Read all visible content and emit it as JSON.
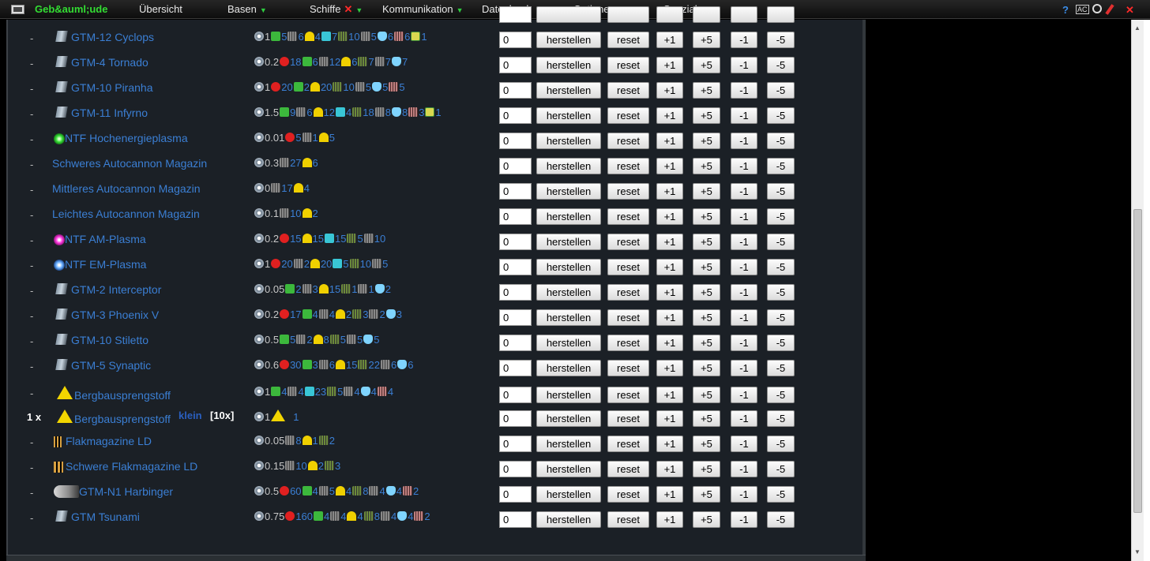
{
  "menu": {
    "items": [
      {
        "label": "Geb&auml;ude",
        "active": true,
        "arrow": false,
        "x": false
      },
      {
        "label": "Übersicht",
        "active": false,
        "arrow": false,
        "x": false
      },
      {
        "label": "Basen",
        "active": false,
        "arrow": true,
        "x": false
      },
      {
        "label": "Schiffe",
        "active": false,
        "arrow": true,
        "x": true
      },
      {
        "label": "Kommunikation",
        "active": false,
        "arrow": true,
        "x": false
      },
      {
        "label": "Datenbank",
        "active": false,
        "arrow": true,
        "x": false
      },
      {
        "label": "Optionen",
        "active": false,
        "arrow": true,
        "x": false
      },
      {
        "label": "Spezial",
        "active": false,
        "arrow": true,
        "x": false
      }
    ],
    "tools": [
      "help-icon",
      "ac-icon",
      "magnifier-icon",
      "pencil-icon",
      "close-icon"
    ],
    "help_glyph": "?",
    "ac_glyph": "AC",
    "close_glyph": "✕",
    "arrow_glyph": "▼",
    "x_glyph": "✕"
  },
  "colors": {
    "link": "#3b7fd4",
    "menu_active": "#33dd33",
    "arrow": "#2ecc40",
    "panel_bg": "#1b2026"
  },
  "buttons": {
    "herstellen": "herstellen",
    "reset": "reset",
    "plus1": "+1",
    "plus5": "+5",
    "minus1": "-1",
    "minus5": "-5"
  },
  "rows": [
    {
      "qty": "-",
      "name": "GTM-12 Cyclops",
      "icon": "ship-icon",
      "value": "0",
      "costs": [
        [
          "time",
          "1"
        ],
        [
          "green",
          "5"
        ],
        [
          "grey",
          "6"
        ],
        [
          "yellow",
          "4"
        ],
        [
          "cyan",
          "7"
        ],
        [
          "olive",
          "10"
        ],
        [
          "grey",
          "5"
        ],
        [
          "crystal",
          "6"
        ],
        [
          "pink",
          "6"
        ],
        [
          "chip",
          "1"
        ]
      ]
    },
    {
      "qty": "-",
      "name": "GTM-4 Tornado",
      "icon": "ship-icon",
      "value": "0",
      "costs": [
        [
          "time",
          "0.2"
        ],
        [
          "red",
          "18"
        ],
        [
          "green",
          "6"
        ],
        [
          "grey",
          "12"
        ],
        [
          "yellow",
          "6"
        ],
        [
          "olive",
          "7"
        ],
        [
          "grey",
          "7"
        ],
        [
          "crystal",
          "7"
        ]
      ]
    },
    {
      "qty": "-",
      "name": "GTM-10 Piranha",
      "icon": "ship-icon",
      "value": "0",
      "costs": [
        [
          "time",
          "1"
        ],
        [
          "red",
          "20"
        ],
        [
          "green",
          "2"
        ],
        [
          "yellow",
          "20"
        ],
        [
          "olive",
          "10"
        ],
        [
          "grey",
          "5"
        ],
        [
          "crystal",
          "5"
        ],
        [
          "pink",
          "5"
        ]
      ]
    },
    {
      "qty": "-",
      "name": "GTM-11 Infyrno",
      "icon": "ship-icon",
      "value": "0",
      "costs": [
        [
          "time",
          "1.5"
        ],
        [
          "green",
          "9"
        ],
        [
          "grey",
          "6"
        ],
        [
          "yellow",
          "12"
        ],
        [
          "cyan",
          "4"
        ],
        [
          "olive",
          "18"
        ],
        [
          "grey",
          "8"
        ],
        [
          "crystal",
          "8"
        ],
        [
          "pink",
          "3"
        ],
        [
          "chip",
          "1"
        ]
      ]
    },
    {
      "qty": "-",
      "name": "NTF Hochenergieplasma",
      "icon": "green-orb-icon",
      "value": "0",
      "costs": [
        [
          "time",
          "0.01"
        ],
        [
          "red",
          "5"
        ],
        [
          "grey",
          "1"
        ],
        [
          "yellow",
          "5"
        ]
      ]
    },
    {
      "qty": "-",
      "name": "Schweres Autocannon Magazin",
      "icon": "",
      "value": "0",
      "costs": [
        [
          "time",
          "0.3"
        ],
        [
          "grey",
          "27"
        ],
        [
          "yellow",
          "6"
        ]
      ]
    },
    {
      "qty": "-",
      "name": "Mittleres Autocannon Magazin",
      "icon": "",
      "value": "0",
      "costs": [
        [
          "time",
          "0"
        ],
        [
          "grey",
          "17"
        ],
        [
          "yellow",
          "4"
        ]
      ]
    },
    {
      "qty": "-",
      "name": "Leichtes Autocannon Magazin",
      "icon": "",
      "value": "0",
      "costs": [
        [
          "time",
          "0.1"
        ],
        [
          "grey",
          "10"
        ],
        [
          "yellow",
          "2"
        ]
      ]
    },
    {
      "qty": "-",
      "name": "NTF AM-Plasma",
      "icon": "pink-orb-icon",
      "value": "0",
      "costs": [
        [
          "time",
          "0.2"
        ],
        [
          "red",
          "15"
        ],
        [
          "yellow",
          "15"
        ],
        [
          "cyan",
          "15"
        ],
        [
          "olive",
          "5"
        ],
        [
          "grey",
          "10"
        ]
      ]
    },
    {
      "qty": "-",
      "name": "NTF EM-Plasma",
      "icon": "blue-orb-icon",
      "value": "0",
      "costs": [
        [
          "time",
          "1"
        ],
        [
          "red",
          "20"
        ],
        [
          "grey",
          "2"
        ],
        [
          "yellow",
          "20"
        ],
        [
          "cyan",
          "5"
        ],
        [
          "olive",
          "10"
        ],
        [
          "grey",
          "5"
        ]
      ]
    },
    {
      "qty": "-",
      "name": "GTM-2 Interceptor",
      "icon": "ship-icon",
      "value": "0",
      "costs": [
        [
          "time",
          "0.05"
        ],
        [
          "green",
          "2"
        ],
        [
          "grey",
          "3"
        ],
        [
          "yellow",
          "15"
        ],
        [
          "olive",
          "1"
        ],
        [
          "grey",
          "1"
        ],
        [
          "crystal",
          "2"
        ]
      ]
    },
    {
      "qty": "-",
      "name": "GTM-3 Phoenix V",
      "icon": "ship-icon",
      "value": "0",
      "costs": [
        [
          "time",
          "0.2"
        ],
        [
          "red",
          "17"
        ],
        [
          "green",
          "4"
        ],
        [
          "grey",
          "4"
        ],
        [
          "yellow",
          "2"
        ],
        [
          "olive",
          "3"
        ],
        [
          "grey",
          "2"
        ],
        [
          "crystal",
          "3"
        ]
      ]
    },
    {
      "qty": "-",
      "name": "GTM-10 Stiletto",
      "icon": "ship-icon",
      "value": "0",
      "costs": [
        [
          "time",
          "0.5"
        ],
        [
          "green",
          "5"
        ],
        [
          "grey",
          "2"
        ],
        [
          "yellow",
          "8"
        ],
        [
          "olive",
          "5"
        ],
        [
          "grey",
          "5"
        ],
        [
          "crystal",
          "5"
        ]
      ]
    },
    {
      "qty": "-",
      "name": "GTM-5 Synaptic",
      "icon": "ship-icon",
      "value": "0",
      "costs": [
        [
          "time",
          "0.6"
        ],
        [
          "red",
          "30"
        ],
        [
          "green",
          "3"
        ],
        [
          "grey",
          "6"
        ],
        [
          "yellow",
          "15"
        ],
        [
          "olive",
          "22"
        ],
        [
          "grey",
          "6"
        ],
        [
          "crystal",
          "6"
        ]
      ]
    },
    {
      "qty": "-",
      "name": "Bergbausprengstoff",
      "icon": "hazard-icon",
      "value": "0",
      "costs": [
        [
          "time",
          "1"
        ],
        [
          "green",
          "4"
        ],
        [
          "grey",
          "4"
        ],
        [
          "cyan",
          "23"
        ],
        [
          "olive",
          "5"
        ],
        [
          "grey",
          "4"
        ],
        [
          "crystal",
          "4"
        ],
        [
          "pink",
          "4"
        ]
      ]
    },
    {
      "qty": "1 x",
      "name": "Bergbausprengstoff",
      "klein": "klein",
      "tenx": "[10x]",
      "icon": "hazard-icon",
      "value": "0",
      "costs": [
        [
          "time",
          "1"
        ],
        [
          "hazard",
          "1"
        ]
      ]
    },
    {
      "qty": "-",
      "name": "Flakmagazine LD",
      "icon": "flak-icon",
      "value": "0",
      "costs": [
        [
          "time",
          "0.05"
        ],
        [
          "grey",
          "8"
        ],
        [
          "yellow",
          "1"
        ],
        [
          "olive",
          "2"
        ]
      ]
    },
    {
      "qty": "-",
      "name": "Schwere Flakmagazine LD",
      "icon": "flak2-icon",
      "value": "0",
      "costs": [
        [
          "time",
          "0.15"
        ],
        [
          "grey",
          "10"
        ],
        [
          "yellow",
          "2"
        ],
        [
          "olive",
          "3"
        ]
      ]
    },
    {
      "qty": "-",
      "name": "GTM-N1 Harbinger",
      "icon": "wide-ship-icon",
      "value": "0",
      "costs": [
        [
          "time",
          "0.5"
        ],
        [
          "red",
          "60"
        ],
        [
          "green",
          "4"
        ],
        [
          "grey",
          "5"
        ],
        [
          "yellow",
          "4"
        ],
        [
          "olive",
          "8"
        ],
        [
          "grey",
          "4"
        ],
        [
          "crystal",
          "4"
        ],
        [
          "pink",
          "2"
        ]
      ]
    },
    {
      "qty": "-",
      "name": "GTM Tsunami",
      "icon": "ship-icon",
      "value": "0",
      "costs": [
        [
          "time",
          "0.75"
        ],
        [
          "red",
          "160"
        ],
        [
          "green",
          "4"
        ],
        [
          "grey",
          "4"
        ],
        [
          "yellow",
          "4"
        ],
        [
          "olive",
          "8"
        ],
        [
          "grey",
          "4"
        ],
        [
          "crystal",
          "4"
        ],
        [
          "pink",
          "2"
        ]
      ]
    }
  ]
}
